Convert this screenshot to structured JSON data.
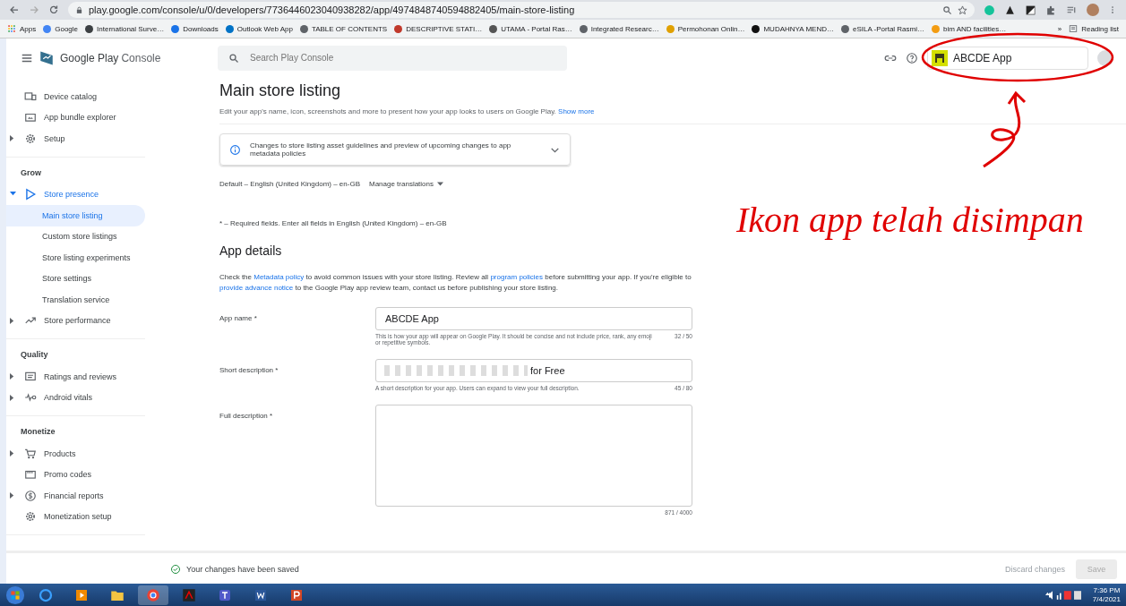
{
  "browser": {
    "url": "play.google.com/console/u/0/developers/7736446023040938282/app/4974848740594882405/main-store-listing",
    "bookmarks": [
      "Apps",
      "Google",
      "International Surve…",
      "Downloads",
      "Outlook Web App",
      "TABLE OF CONTENTS",
      "DESCRIPTIVE STATI…",
      "UTAMA - Portal Ras…",
      "Integrated Researc…",
      "Permohonan Onlin…",
      "MUDAHNYA MEND…",
      "eSILA -Portal Rasmi…",
      "bim AND facilities…"
    ],
    "more": "»",
    "reading_list": "Reading list"
  },
  "header": {
    "brand": "Google Play",
    "brand_suffix": "Console",
    "search": {
      "placeholder": "Search Play Console"
    },
    "app_name": "ABCDE App"
  },
  "sidebar": {
    "sections": [
      {
        "items": [
          {
            "label": "Device catalog",
            "selected": false
          },
          {
            "label": "App bundle explorer",
            "selected": false
          },
          {
            "label": "Setup",
            "selected": false,
            "expanded": false
          }
        ]
      },
      {
        "title": "Grow",
        "items": [
          {
            "label": "Store presence",
            "selected": false,
            "expanded": true,
            "children": [
              {
                "label": "Main store listing",
                "selected": true
              },
              {
                "label": "Custom store listings",
                "selected": false
              },
              {
                "label": "Store listing experiments",
                "selected": false
              },
              {
                "label": "Store settings",
                "selected": false
              },
              {
                "label": "Translation service",
                "selected": false
              }
            ]
          },
          {
            "label": "Store performance",
            "selected": false,
            "expanded": false
          }
        ]
      },
      {
        "title": "Quality",
        "items": [
          {
            "label": "Ratings and reviews",
            "selected": false,
            "expanded": false
          },
          {
            "label": "Android vitals",
            "selected": false,
            "expanded": false
          }
        ]
      },
      {
        "title": "Monetize",
        "items": [
          {
            "label": "Products",
            "selected": false,
            "expanded": false
          },
          {
            "label": "Promo codes",
            "selected": false
          },
          {
            "label": "Financial reports",
            "selected": false,
            "expanded": false
          },
          {
            "label": "Monetization setup",
            "selected": false
          }
        ]
      }
    ]
  },
  "main": {
    "title": "Main store listing",
    "subtitle": "Edit your app's name, icon, screenshots and more to present how your app looks to users on Google Play.",
    "show_more": "Show more",
    "notice": {
      "text": "Changes to store listing asset guidelines and preview of upcoming changes to app metadata policies",
      "expanded": false
    },
    "language": "Default – English (United Kingdom) – en-GB",
    "manage_translations": "Manage translations",
    "required_note": "* – Required fields. Enter all fields in English (United Kingdom) – en-GB",
    "section_title": "App details",
    "policy_text": [
      {
        "text": "Check the ",
        "link": false
      },
      {
        "text": "Metadata policy",
        "link": true
      },
      {
        "text": " to avoid common issues with your store listing. Review all ",
        "link": false
      },
      {
        "text": "program policies",
        "link": true
      },
      {
        "text": " before submitting your app. If you're eligible to ",
        "link": false
      },
      {
        "text": "provide advance notice",
        "link": true
      },
      {
        "text": " to the Google Play app review team, contact us before publishing your store listing.",
        "link": false
      }
    ],
    "fields": [
      {
        "kind": "input",
        "label": "App name *",
        "value": "ABCDE App",
        "redacted": false,
        "helper": "This is how your app will appear on Google Play. It should be concise and not include price, rank, any emoji or repetitive symbols.",
        "counter": "32 / 50"
      },
      {
        "kind": "input",
        "label": "Short description *",
        "value": "for Free",
        "redacted": true,
        "helper": "A short description for your app. Users can expand to view your full description.",
        "counter": "45 / 80"
      },
      {
        "kind": "textarea",
        "label": "Full description *",
        "counter": "871 / 4000"
      }
    ]
  },
  "footer": {
    "status": "Your changes have been saved",
    "discard": "Discard changes",
    "save": {
      "label": "Save",
      "disabled": true
    }
  },
  "taskbar": {
    "time": "7:36 PM",
    "date": "7/4/2021"
  },
  "annotation": {
    "text": "Ikon app telah disimpan"
  }
}
